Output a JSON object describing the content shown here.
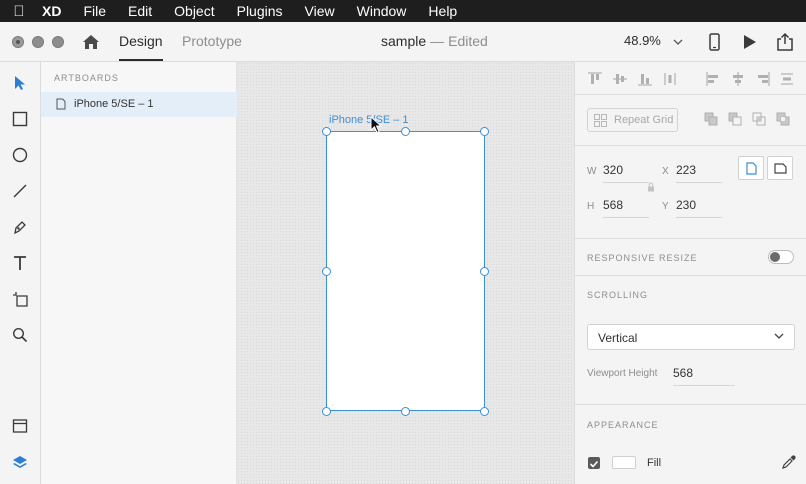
{
  "menubar": {
    "app": "XD",
    "items": [
      "File",
      "Edit",
      "Object",
      "Plugins",
      "View",
      "Window",
      "Help"
    ]
  },
  "titlebar": {
    "tabs": {
      "design": "Design",
      "prototype": "Prototype"
    },
    "document": {
      "name": "sample",
      "separator": "—",
      "status": "Edited"
    },
    "zoom": "48.9%"
  },
  "layers": {
    "header": "ARTBOARDS",
    "items": [
      {
        "label": "iPhone 5/SE – 1"
      }
    ]
  },
  "canvas": {
    "artboard_label": "iPhone 5/SE – 1"
  },
  "inspector": {
    "repeat_grid": "Repeat Grid",
    "w_label": "W",
    "w_value": "320",
    "h_label": "H",
    "h_value": "568",
    "x_label": "X",
    "x_value": "223",
    "y_label": "Y",
    "y_value": "230",
    "responsive_resize": "RESPONSIVE RESIZE",
    "scrolling": "SCROLLING",
    "scroll_mode": "Vertical",
    "viewport_height_label": "Viewport Height",
    "viewport_height_value": "568",
    "appearance": "APPEARANCE",
    "fill_label": "Fill",
    "fill_checked": true,
    "fill_color": "#FFFFFF",
    "responsive_resize_on": false
  },
  "colors": {
    "accent": "#3d8fd6",
    "menubar": "#1e1e1e",
    "panel": "#f4f4f4"
  }
}
